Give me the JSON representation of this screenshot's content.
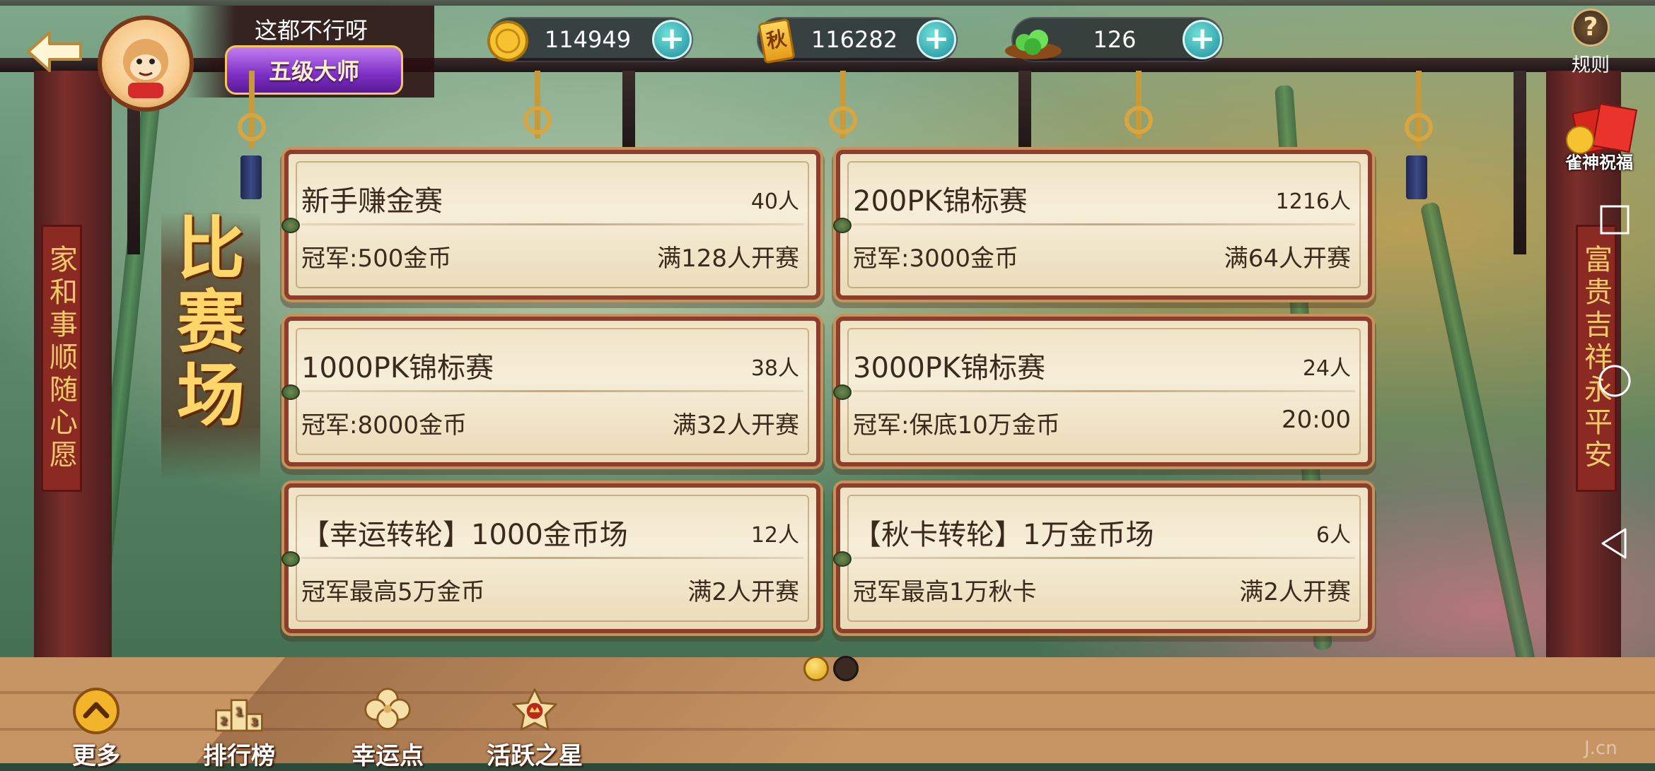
{
  "header": {
    "player_name": "这都不行呀",
    "rank_badge": "五级大师",
    "resources": [
      {
        "icon": "gold-coin-icon",
        "value": "114949"
      },
      {
        "icon": "autumn-card-icon",
        "icon_text": "秋",
        "value": "116282"
      },
      {
        "icon": "green-gem-icon",
        "value": "126"
      }
    ],
    "rules_label": "规则",
    "blessing_label": "雀神祝福"
  },
  "title": [
    "比",
    "赛",
    "场"
  ],
  "couplets": {
    "left": "家和事顺随心愿",
    "right": "富贵吉祥永平安"
  },
  "matches": [
    {
      "name": "新手赚金赛",
      "players": "40人",
      "prize": "冠军:500金币",
      "condition": "满128人开赛"
    },
    {
      "name": "200PK锦标赛",
      "players": "1216人",
      "prize": "冠军:3000金币",
      "condition": "满64人开赛"
    },
    {
      "name": "1000PK锦标赛",
      "players": "38人",
      "prize": "冠军:8000金币",
      "condition": "满32人开赛"
    },
    {
      "name": "3000PK锦标赛",
      "players": "24人",
      "prize": "冠军:保底10万金币",
      "condition": "20:00"
    },
    {
      "name": "【幸运转轮】1000金币场",
      "players": "12人",
      "prize": "冠军最高5万金币",
      "condition": "满2人开赛"
    },
    {
      "name": "【秋卡转轮】1万金币场",
      "players": "6人",
      "prize": "冠军最高1万秋卡",
      "condition": "满2人开赛"
    }
  ],
  "pagination": {
    "current": 1,
    "total": 2
  },
  "bottom_nav": [
    {
      "label": "更多",
      "icon": "chevron-up-icon"
    },
    {
      "label": "排行榜",
      "icon": "podium-icon"
    },
    {
      "label": "幸运点",
      "icon": "clover-icon"
    },
    {
      "label": "活跃之星",
      "icon": "star-crown-icon"
    }
  ],
  "watermark": "J.cn",
  "colors": {
    "accent_gold": "#f6c65a",
    "card_border": "#8c3d2c",
    "plus_teal": "#1f8d9c",
    "rank_purple": "#7e2fc5"
  }
}
